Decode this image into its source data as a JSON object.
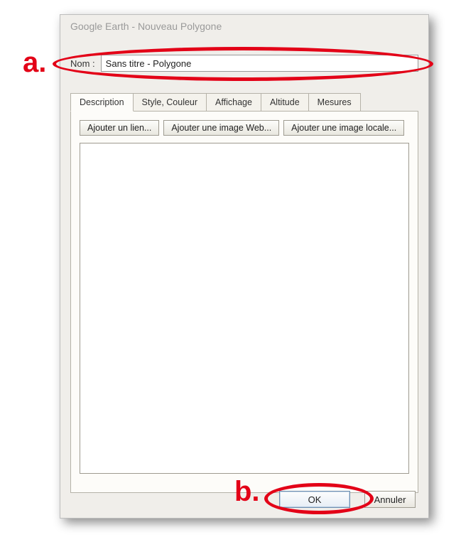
{
  "window": {
    "title": "Google Earth - Nouveau Polygone"
  },
  "name": {
    "label": "Nom :",
    "value": "Sans titre - Polygone"
  },
  "tabs": {
    "description": "Description",
    "style": "Style, Couleur",
    "display": "Affichage",
    "altitude": "Altitude",
    "measures": "Mesures"
  },
  "description_panel": {
    "add_link": "Ajouter un lien...",
    "add_web_image": "Ajouter une image Web...",
    "add_local_image": "Ajouter une image locale..."
  },
  "footer": {
    "ok": "OK",
    "cancel": "Annuler"
  },
  "annotations": {
    "a": "a.",
    "b": "b."
  }
}
